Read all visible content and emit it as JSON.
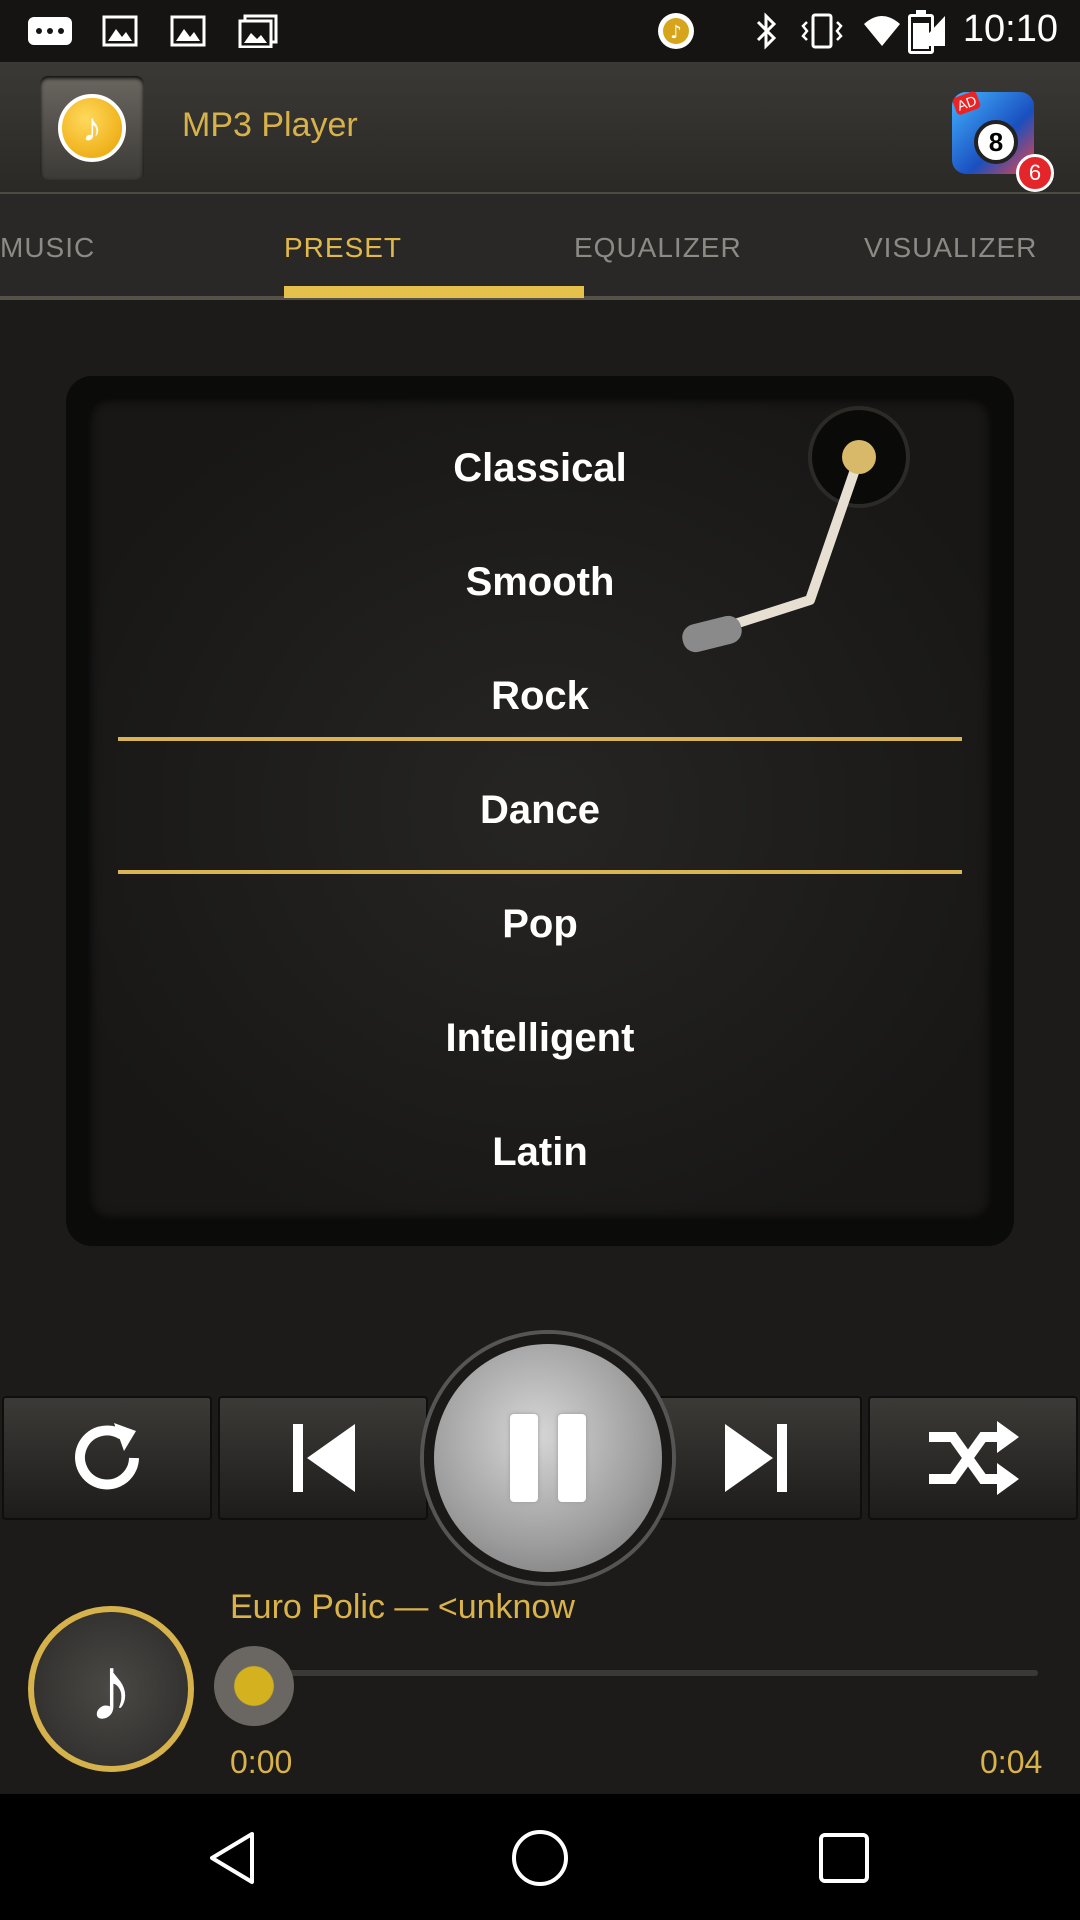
{
  "status_bar": {
    "time": "10:10",
    "icons": [
      "more-icon",
      "picture-icon",
      "picture-icon",
      "gallery-icon",
      "music-app-icon",
      "bluetooth-icon",
      "vibrate-icon",
      "wifi-icon",
      "signal-icon",
      "battery-icon"
    ]
  },
  "header": {
    "title": "MP3 Player",
    "ad_badge_label": "AD",
    "ad_badge_ball": "8",
    "notification_count": "6"
  },
  "tabs": [
    {
      "label": "MUSIC",
      "active": false
    },
    {
      "label": "PRESET",
      "active": true
    },
    {
      "label": "EQUALIZER",
      "active": false
    },
    {
      "label": "VISUALIZER",
      "active": false
    }
  ],
  "presets": {
    "items": [
      "Classical",
      "Smooth",
      "Rock",
      "Dance",
      "Pop",
      "Intelligent",
      "Latin"
    ],
    "selected": "Dance"
  },
  "controls": {
    "buttons": [
      "repeat-icon",
      "previous-icon",
      "pause-icon",
      "next-icon",
      "shuffle-icon"
    ]
  },
  "now_playing": {
    "title": "Euro Polic — <unknow",
    "time_current": "0:00",
    "time_total": "0:04",
    "progress": 0.0
  },
  "colors": {
    "accent": "#e1b94a",
    "background": "#1c1b19",
    "selection_line": "#d8b454"
  }
}
